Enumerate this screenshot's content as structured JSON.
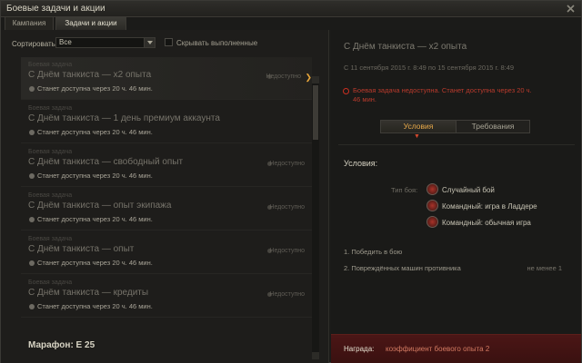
{
  "window": {
    "title": "Боевые задачи и акции",
    "tabs": [
      {
        "label": "Кампания",
        "active": false
      },
      {
        "label": "Задачи и акции",
        "active": true
      }
    ]
  },
  "filters": {
    "sort_label": "Сортировать:",
    "sort_value": "Все",
    "hide_completed_label": "Скрывать выполненные",
    "hide_completed_checked": false
  },
  "quests": [
    {
      "category": "Боевая задача",
      "name": "С Днём танкиста — x2 опыта",
      "status": "Недоступно",
      "availability": "Станет доступна через 20 ч. 46 мин.",
      "selected": true
    },
    {
      "category": "Боевая задача",
      "name": "С Днём танкиста — 1 день премиум аккаунта",
      "status": "",
      "availability": "Станет доступна через 20 ч. 46 мин.",
      "selected": false
    },
    {
      "category": "Боевая задача",
      "name": "С Днём танкиста — свободный опыт",
      "status": "Недоступно",
      "availability": "Станет доступна через 20 ч. 46 мин.",
      "selected": false
    },
    {
      "category": "Боевая задача",
      "name": "С Днём танкиста — опыт экипажа",
      "status": "Недоступно",
      "availability": "Станет доступна через 20 ч. 46 мин.",
      "selected": false
    },
    {
      "category": "Боевая задача",
      "name": "С Днём танкиста — опыт",
      "status": "Недоступно",
      "availability": "Станет доступна через 20 ч. 46 мин.",
      "selected": false
    },
    {
      "category": "Боевая задача",
      "name": "С Днём танкиста — кредиты",
      "status": "Недоступно",
      "availability": "Станет доступна через 20 ч. 46 мин.",
      "selected": false
    }
  ],
  "marathon": "Марафон: Е 25",
  "details": {
    "title": "С Днём танкиста — x2 опыта",
    "dates": "С 11 сентября 2015 г. 8:49 по 15 сентября 2015 г. 8:49",
    "warning": "Боевая задача недоступна. Станет доступна через 20 ч. 46 мин.",
    "tabs": {
      "conditions": "Условия",
      "requirements": "Требования"
    },
    "conditions_title": "Условия:",
    "battle_type_label": "Тип боя:",
    "battle_types": [
      "Случайный бой",
      "Командный: игра в Ладдере",
      "Командный: обычная игра"
    ],
    "tasks": [
      {
        "text": "1. Победить в бою",
        "extra": ""
      },
      {
        "text": "2. Повреждённых машин противника",
        "extra": "не менее 1"
      }
    ],
    "reward_label": "Награда:",
    "reward_value": "коэффициент боевого опыта 2"
  },
  "colors": {
    "accent": "#e8a94a",
    "warning": "#b93a2c",
    "reward_bg": "#4b1616"
  },
  "icons": {
    "close": "close-icon",
    "lock": "lock-icon",
    "battle": "battle-type-icon",
    "warning": "warning-icon"
  }
}
